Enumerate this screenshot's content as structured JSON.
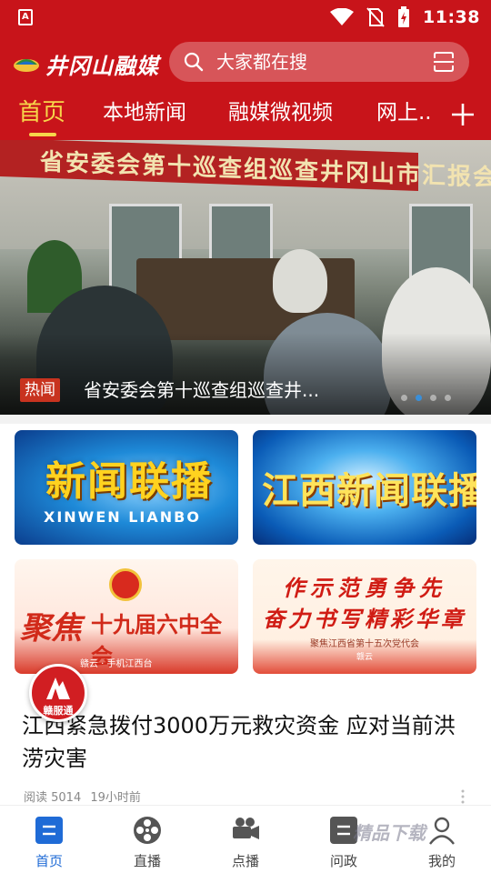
{
  "status_bar": {
    "time": "11:38"
  },
  "header": {
    "logo_text": "井冈山融媒",
    "search_placeholder": "大家都在搜"
  },
  "tabs": [
    {
      "label": "首页",
      "active": true
    },
    {
      "label": "本地新闻"
    },
    {
      "label": "融媒微视频"
    },
    {
      "label": "网上..."
    }
  ],
  "banner": {
    "sign_text": "省安委会第十巡查组巡查井冈山市汇报会",
    "tag": "热闻",
    "title": "省安委会第十巡查组巡查井...",
    "slide_count": 4,
    "active_slide": 2
  },
  "cards": [
    {
      "main": "新闻联播",
      "sub": "XINWEN LIANBO"
    },
    {
      "main": "江西新闻联播"
    },
    {
      "main_left": "聚焦",
      "main_right": "十九届六中全会",
      "foot": "赣云 · 手机江西台"
    },
    {
      "line1": "作示范勇争先",
      "line2": "奋力书写精彩华章",
      "line3": "聚焦江西省第十五次党代会",
      "foot": "赣云"
    }
  ],
  "fab": {
    "label": "赣服通"
  },
  "article": {
    "title": "江西紧急拨付3000万元救灾资金 应对当前洪涝灾害",
    "reads": "阅读 5014",
    "time": "19小时前"
  },
  "bottom_nav": [
    {
      "label": "首页",
      "icon": "home-icon",
      "active": true
    },
    {
      "label": "直播",
      "icon": "film-reel-icon"
    },
    {
      "label": "点播",
      "icon": "video-camera-icon"
    },
    {
      "label": "问政",
      "icon": "document-icon"
    },
    {
      "label": "我的",
      "icon": "person-icon"
    }
  ],
  "watermark": "精品下载",
  "colors": {
    "brand_red": "#c8141a",
    "tab_active": "#f7d54a",
    "nav_active": "#1f6bd6"
  }
}
